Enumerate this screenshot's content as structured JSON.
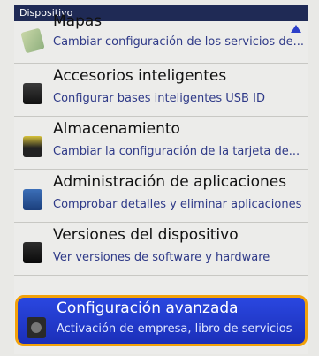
{
  "titlebar": {
    "title": "Dispositivo"
  },
  "items": [
    {
      "icon": "map-icon",
      "title": "Mapas",
      "subtitle": "Cambiar configuración de los servicios de..."
    },
    {
      "icon": "smart-accessory-icon",
      "title": "Accesorios inteligentes",
      "subtitle": "Configurar bases inteligentes USB ID"
    },
    {
      "icon": "storage-card-icon",
      "title": "Almacenamiento",
      "subtitle": "Cambiar la configuración de la tarjeta de..."
    },
    {
      "icon": "applications-icon",
      "title": "Administración de aplicaciones",
      "subtitle": "Comprobar detalles y eliminar aplicaciones"
    },
    {
      "icon": "device-versions-icon",
      "title": "Versiones del dispositivo",
      "subtitle": "Ver versiones de software y hardware"
    },
    {
      "icon": "advanced-settings-icon",
      "title": "Configuración avanzada",
      "subtitle": "Activación de empresa, libro de servicios",
      "selected": true
    }
  ],
  "colors": {
    "selection_fill": "#2a47e0",
    "selection_border": "#f3a20a",
    "titlebar": "#1f2a55"
  }
}
